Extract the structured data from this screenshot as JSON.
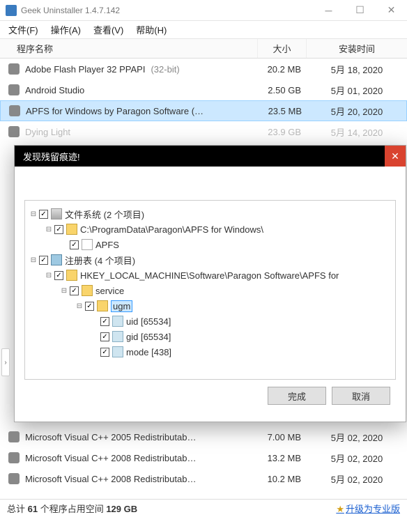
{
  "window": {
    "title": "Geek Uninstaller 1.4.7.142"
  },
  "menu": {
    "file": "文件(F)",
    "action": "操作(A)",
    "view": "查看(V)",
    "help": "帮助(H)"
  },
  "columns": {
    "name": "程序名称",
    "size": "大小",
    "date": "安装时间"
  },
  "list_top": [
    {
      "name": "Adobe Flash Player 32 PPAPI",
      "suffix": "(32-bit)",
      "size": "20.2 MB",
      "date": "5月 18, 2020"
    },
    {
      "name": "Android Studio",
      "suffix": "",
      "size": "2.50 GB",
      "date": "5月 01, 2020"
    },
    {
      "name": "APFS for Windows by Paragon Software (…",
      "suffix": "",
      "size": "23.5 MB",
      "date": "5月 20, 2020",
      "selected": true
    },
    {
      "name": "Dying Light",
      "suffix": "",
      "size": "23.9 GB",
      "date": "5月 14, 2020",
      "faded": true
    }
  ],
  "list_bottom": [
    {
      "name": "Microsoft Visual C++ 2005 Redistributab…",
      "size": "7.00 MB",
      "date": "5月 02, 2020"
    },
    {
      "name": "Microsoft Visual C++ 2008 Redistributab…",
      "size": "13.2 MB",
      "date": "5月 02, 2020"
    },
    {
      "name": "Microsoft Visual C++ 2008 Redistributab…",
      "size": "10.2 MB",
      "date": "5月 02, 2020"
    }
  ],
  "dialog": {
    "title": "发现残留痕迹!",
    "fs_label": "文件系统 (2 个项目)",
    "fs_path": "C:\\ProgramData\\Paragon\\APFS for Windows\\",
    "fs_file": "APFS",
    "reg_label": "注册表 (4 个项目)",
    "reg_path": "HKEY_LOCAL_MACHINE\\Software\\Paragon Software\\APFS for",
    "reg_service": "service",
    "reg_ugm": "ugm",
    "reg_vals": [
      "uid [65534]",
      "gid [65534]",
      "mode [438]"
    ],
    "ok": "完成",
    "cancel": "取消"
  },
  "status": {
    "text_a": "总计 ",
    "count": "61",
    "text_b": " 个程序占用空间 ",
    "space": "129 GB",
    "upgrade": "升级为专业版"
  }
}
